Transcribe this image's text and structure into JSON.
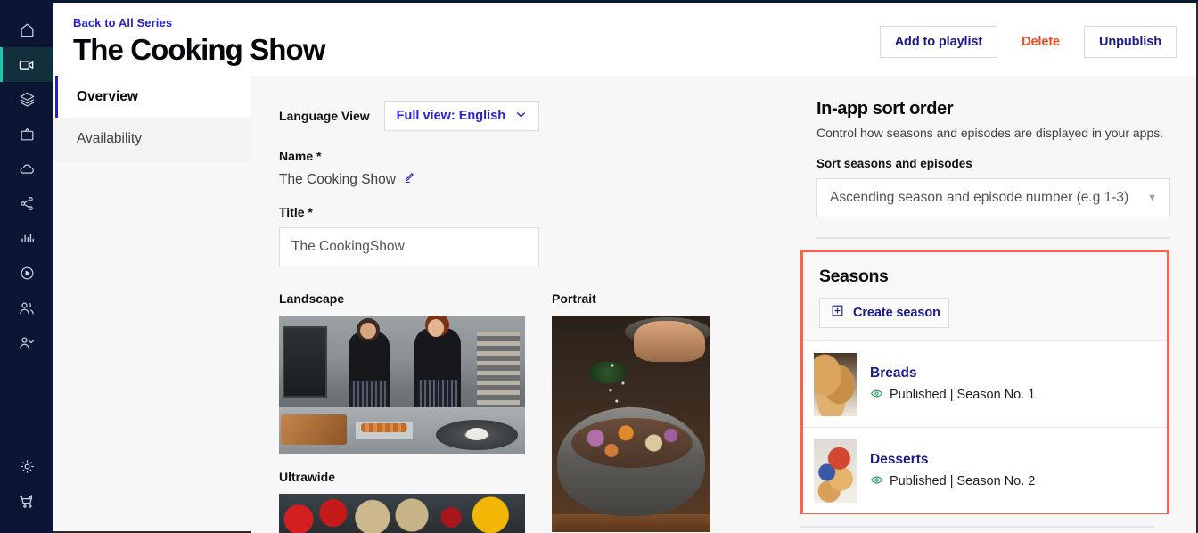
{
  "rail": {
    "items": [
      {
        "name": "home-icon",
        "label": "Home"
      },
      {
        "name": "video-camera-icon",
        "label": "Videos"
      },
      {
        "name": "layers-icon",
        "label": "Collections"
      },
      {
        "name": "tv-icon",
        "label": "Apps"
      },
      {
        "name": "cloud-icon",
        "label": "Cloud"
      },
      {
        "name": "share-icon",
        "label": "Distribution"
      },
      {
        "name": "bar-chart-icon",
        "label": "Analytics"
      },
      {
        "name": "play-circle-icon",
        "label": "Player"
      },
      {
        "name": "users-icon",
        "label": "Audience"
      },
      {
        "name": "user-check-icon",
        "label": "Subscribers"
      }
    ],
    "bottom_items": [
      {
        "name": "gear-icon",
        "label": "Settings"
      },
      {
        "name": "cart-icon",
        "label": "Store"
      }
    ]
  },
  "header": {
    "back_link": "Back to All Series",
    "title": "The Cooking Show",
    "actions": [
      {
        "label": "Add to playlist",
        "style": "bordered"
      },
      {
        "label": "Delete",
        "style": "danger"
      },
      {
        "label": "Unpublish",
        "style": "bordered"
      }
    ]
  },
  "tabs": [
    {
      "label": "Overview",
      "active": true
    },
    {
      "label": "Availability",
      "active": false
    }
  ],
  "main": {
    "language_view_label": "Language View",
    "language_view_value": "Full view: English",
    "name_label": "Name *",
    "name_value": "The Cooking Show",
    "edit_icon": "pencil-icon",
    "title_label": "Title *",
    "title_value": "The CookingShow",
    "media": [
      {
        "label": "Landscape"
      },
      {
        "label": "Portrait"
      },
      {
        "label": "Ultrawide"
      }
    ]
  },
  "sort_panel": {
    "title": "In-app sort order",
    "subtitle": "Control how seasons and episodes are displayed in your apps.",
    "field_label": "Sort seasons and episodes",
    "selected_option": "Ascending season and episode number (e.g 1-3)",
    "caret": "▼"
  },
  "seasons_panel": {
    "title": "Seasons",
    "create_label": "Create season",
    "create_icon": "plus-box-icon",
    "highlight_color": "#f9634b",
    "rows": [
      {
        "name": "Breads",
        "status": "Published | Season No. 1",
        "status_icon": "eye-icon",
        "thumb": "breads-thumbnail"
      },
      {
        "name": "Desserts",
        "status": "Published | Season No. 2",
        "status_icon": "eye-icon",
        "thumb": "desserts-thumbnail"
      }
    ]
  },
  "colors": {
    "rail_bg": "#0a1633",
    "rail_active_bg": "#11303c",
    "link_navy": "#1a1a8c",
    "accent_blue": "#2622c9",
    "danger_orange": "#f04a1e",
    "published_green": "#159a4f",
    "highlight_red": "#f9634b",
    "page_bg": "#f7f7f8"
  }
}
